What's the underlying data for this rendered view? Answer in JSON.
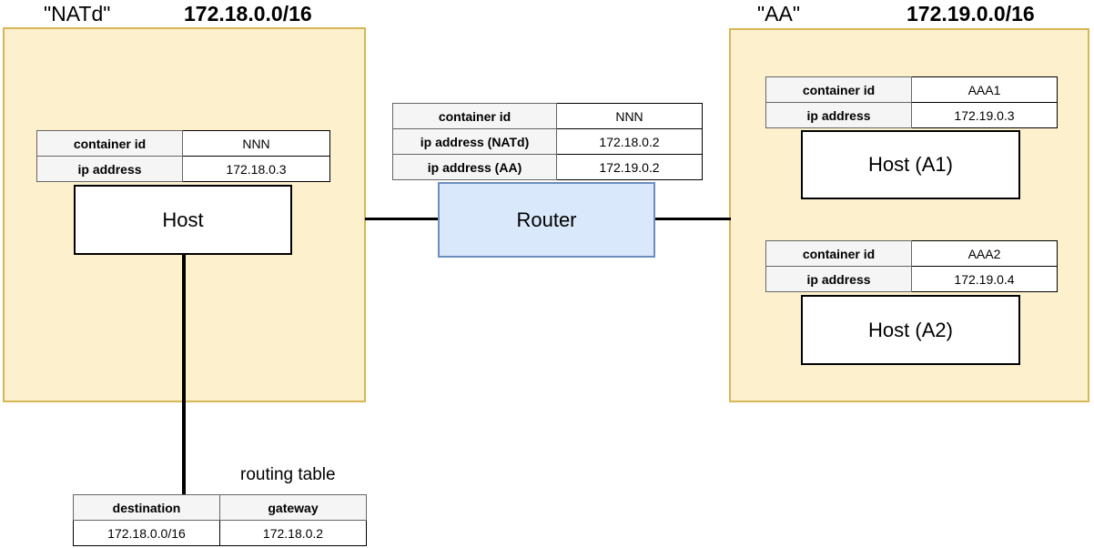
{
  "networks": [
    {
      "name": "\"NATd\"",
      "cidr": "172.18.0.0/16"
    },
    {
      "name": "\"AA\"",
      "cidr": "172.19.0.0/16"
    }
  ],
  "nodes": {
    "nat_host": {
      "label": "Host",
      "table": {
        "rows": [
          {
            "key": "container id",
            "value": "NNN"
          },
          {
            "key": "ip address",
            "value": "172.18.0.3"
          }
        ]
      }
    },
    "router": {
      "label": "Router",
      "table": {
        "rows": [
          {
            "key": "container id",
            "value": "NNN"
          },
          {
            "key": "ip address (NATd)",
            "value": "172.18.0.2"
          },
          {
            "key": "ip address (AA)",
            "value": "172.19.0.2"
          }
        ]
      }
    },
    "host_a1": {
      "label": "Host (A1)",
      "table": {
        "rows": [
          {
            "key": "container id",
            "value": "AAA1"
          },
          {
            "key": "ip address",
            "value": "172.19.0.3"
          }
        ]
      }
    },
    "host_a2": {
      "label": "Host (A2)",
      "table": {
        "rows": [
          {
            "key": "container id",
            "value": "AAA2"
          },
          {
            "key": "ip address",
            "value": "172.19.0.4"
          }
        ]
      }
    }
  },
  "routing_table": {
    "caption": "routing table",
    "columns": [
      "destination",
      "gateway"
    ],
    "rows": [
      [
        "172.18.0.0/16",
        "172.18.0.2"
      ]
    ]
  },
  "colors": {
    "network_fill": "#fdf0cd",
    "network_border": "#d6b656",
    "router_fill": "#dae8fc",
    "router_border": "#6c8ebf",
    "table_header_fill": "#f5f5f5",
    "node_border": "#000000",
    "line": "#000000"
  }
}
